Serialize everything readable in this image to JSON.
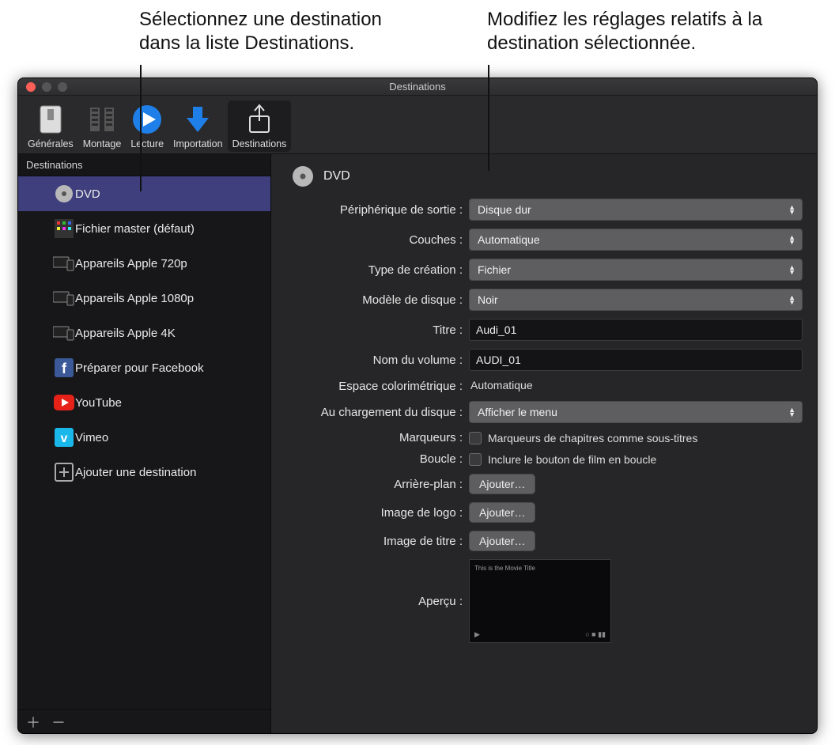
{
  "callout_left": "Sélectionnez une destination dans la liste Destinations.",
  "callout_right": "Modifiez les réglages relatifs à la destination sélectionnée.",
  "window_title": "Destinations",
  "toolbar": {
    "generales": "Générales",
    "montage": "Montage",
    "lecture": "Lecture",
    "importation": "Importation",
    "destinations": "Destinations"
  },
  "sidebar": {
    "header": "Destinations",
    "items": [
      {
        "label": "DVD"
      },
      {
        "label": "Fichier master (défaut)"
      },
      {
        "label": "Appareils Apple 720p"
      },
      {
        "label": "Appareils Apple 1080p"
      },
      {
        "label": "Appareils Apple 4K"
      },
      {
        "label": "Préparer pour Facebook"
      },
      {
        "label": "YouTube"
      },
      {
        "label": "Vimeo"
      },
      {
        "label": "Ajouter une destination"
      }
    ]
  },
  "detail": {
    "title": "DVD",
    "labels": {
      "output_device": "Périphérique de sortie :",
      "layers": "Couches :",
      "build_type": "Type de création :",
      "disc_template": "Modèle de disque :",
      "title": "Titre :",
      "volume_name": "Nom du volume :",
      "color_space": "Espace colorimétrique :",
      "on_load": "Au chargement du disque :",
      "markers": "Marqueurs :",
      "loop": "Boucle :",
      "background": "Arrière-plan :",
      "logo_image": "Image de logo :",
      "title_image": "Image de titre :",
      "preview": "Aperçu :"
    },
    "values": {
      "output_device": "Disque dur",
      "layers": "Automatique",
      "build_type": "Fichier",
      "disc_template": "Noir",
      "title": "Audi_01",
      "volume_name": "AUDI_01",
      "color_space": "Automatique",
      "on_load": "Afficher le menu",
      "markers_checkbox": "Marqueurs de chapitres comme sous-titres",
      "loop_checkbox": "Inclure le bouton de film en boucle",
      "add_button": "Ajouter…",
      "preview_text": "This is the Movie Title"
    }
  }
}
